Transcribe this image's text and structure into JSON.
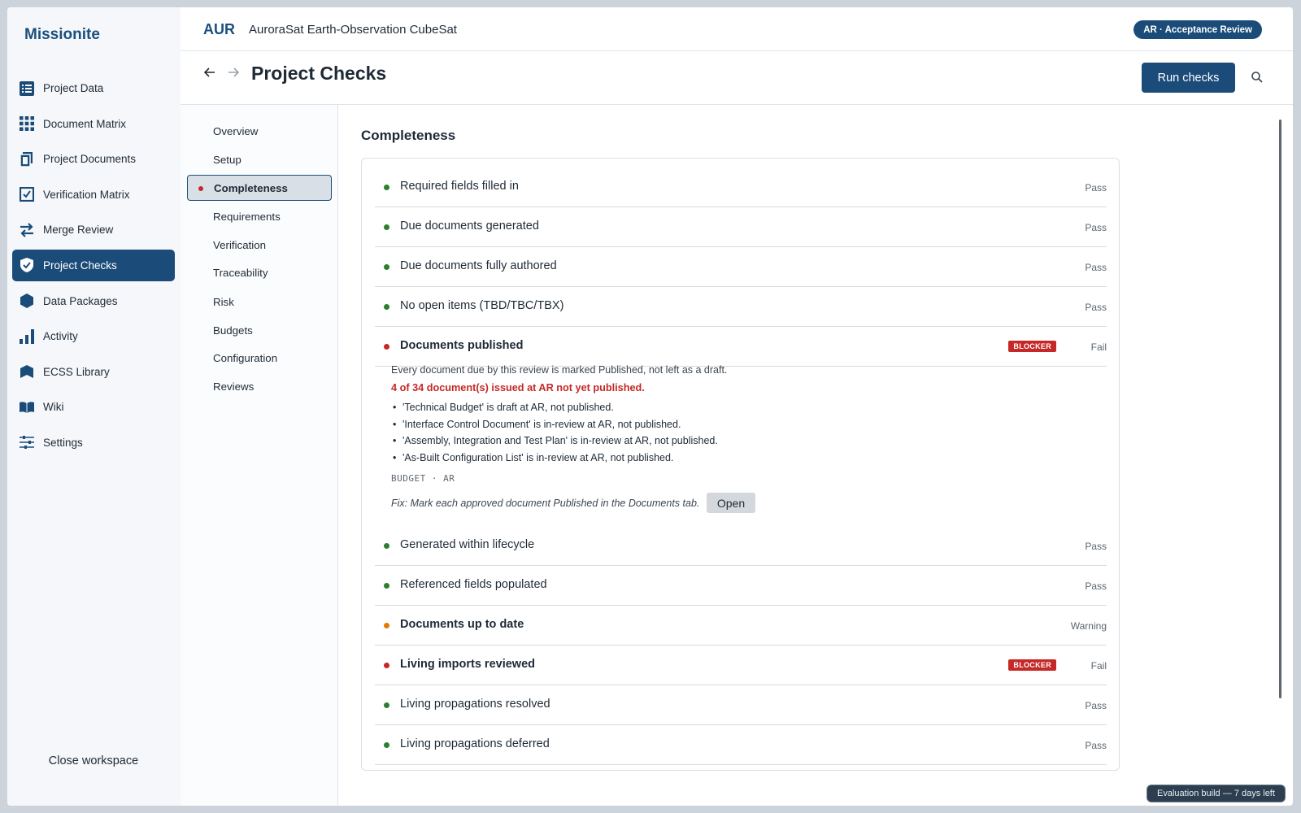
{
  "app": {
    "brand": "Missionite"
  },
  "sidebar": {
    "items": [
      {
        "label": "Project Data",
        "icon": "list-icon"
      },
      {
        "label": "Document Matrix",
        "icon": "grid-icon"
      },
      {
        "label": "Project Documents",
        "icon": "document-icon"
      },
      {
        "label": "Verification Matrix",
        "icon": "checkbox-icon"
      },
      {
        "label": "Merge Review",
        "icon": "swap-arrows-icon"
      },
      {
        "label": "Project Checks",
        "icon": "shield-check-icon",
        "active": true
      },
      {
        "label": "Data Packages",
        "icon": "package-hexagon-icon"
      },
      {
        "label": "Activity",
        "icon": "bar-chart-icon"
      },
      {
        "label": "ECSS Library",
        "icon": "library-icon"
      },
      {
        "label": "Wiki",
        "icon": "book-icon"
      },
      {
        "label": "Settings",
        "icon": "sliders-icon"
      }
    ],
    "close_label": "Close workspace"
  },
  "header": {
    "project_code": "AUR",
    "project_name": "AuroraSat Earth-Observation CubeSat",
    "review_badge": "AR · Acceptance Review"
  },
  "titlebar": {
    "back_icon": "arrow-left-icon",
    "forward_icon": "arrow-right-icon",
    "title": "Project Checks",
    "run_label": "Run checks",
    "search_icon": "search-icon"
  },
  "subnav": {
    "items": [
      {
        "label": "Overview"
      },
      {
        "label": "Setup"
      },
      {
        "label": "Completeness",
        "active": true
      },
      {
        "label": "Requirements"
      },
      {
        "label": "Verification"
      },
      {
        "label": "Traceability"
      },
      {
        "label": "Risk"
      },
      {
        "label": "Budgets"
      },
      {
        "label": "Configuration"
      },
      {
        "label": "Reviews"
      }
    ]
  },
  "main": {
    "section_title": "Completeness",
    "checks": [
      {
        "label": "Required fields filled in",
        "status": "Pass",
        "state": "pass"
      },
      {
        "label": "Due documents generated",
        "status": "Pass",
        "state": "pass"
      },
      {
        "label": "Due documents fully authored",
        "status": "Pass",
        "state": "pass"
      },
      {
        "label": "No open items (TBD/TBC/TBX)",
        "status": "Pass",
        "state": "pass"
      },
      {
        "label": "Documents published",
        "status": "Fail",
        "state": "fail",
        "badge": "BLOCKER"
      },
      {
        "label": "Generated within lifecycle",
        "status": "Pass",
        "state": "pass"
      },
      {
        "label": "Referenced fields populated",
        "status": "Pass",
        "state": "pass"
      },
      {
        "label": "Documents up to date",
        "status": "Warning",
        "state": "warn"
      },
      {
        "label": "Living imports reviewed",
        "status": "Fail",
        "state": "fail",
        "badge": "BLOCKER"
      },
      {
        "label": "Living propagations resolved",
        "status": "Pass",
        "state": "pass"
      },
      {
        "label": "Living propagations deferred",
        "status": "Pass",
        "state": "pass"
      }
    ],
    "detail": {
      "description": "Every document due by this review is marked Published, not left as a draft.",
      "error": "4 of 34 document(s) issued at AR not yet published.",
      "items": [
        "'Technical Budget' is draft at AR, not published.",
        "'Interface Control Document' is in-review at AR, not published.",
        "'Assembly, Integration and Test Plan' is in-review at AR, not published.",
        "'As-Built Configuration List' is in-review at AR, not published."
      ],
      "tag": "BUDGET · AR",
      "fix": "Fix: Mark each approved document Published in the Documents tab.",
      "open_label": "Open"
    }
  },
  "footer": {
    "eval_badge": "Evaluation build — 7 days left"
  },
  "colors": {
    "brand": "#1b4c79",
    "pass": "#2e7d32",
    "fail": "#c62828",
    "warn": "#e07b00"
  }
}
